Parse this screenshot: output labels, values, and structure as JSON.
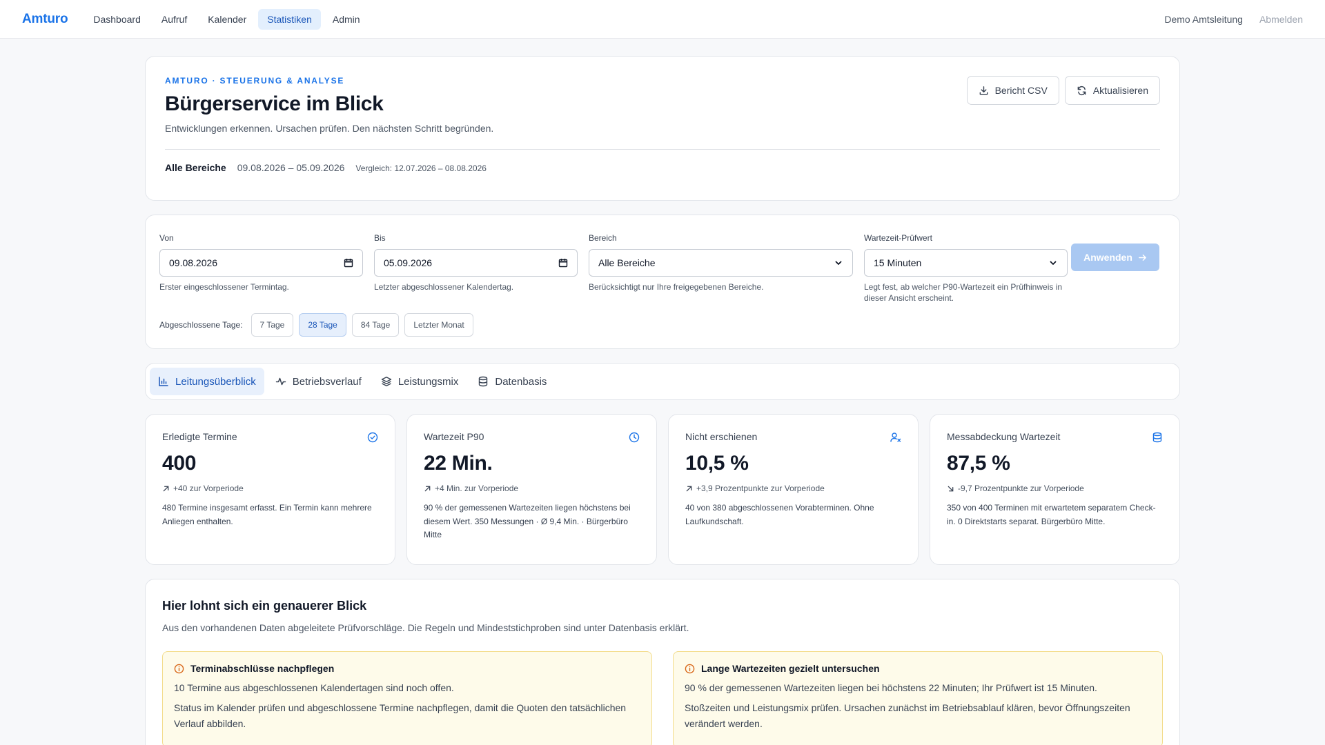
{
  "nav": {
    "brand": "Amturo",
    "links": [
      "Dashboard",
      "Aufruf",
      "Kalender",
      "Statistiken",
      "Admin"
    ],
    "active": "Statistiken",
    "user": "Demo Amtsleitung",
    "logout": "Abmelden"
  },
  "hero": {
    "eyebrow": "AMTURO · STEUERUNG & ANALYSE",
    "title": "Bürgerservice im Blick",
    "subtitle": "Entwicklungen erkennen. Ursachen prüfen. Den nächsten Schritt begründen.",
    "area": "Alle Bereiche",
    "range": "09.08.2026 – 05.09.2026",
    "compare": "Vergleich: 12.07.2026 – 08.08.2026",
    "btn_csv": "Bericht CSV",
    "btn_refresh": "Aktualisieren"
  },
  "filters": {
    "von": {
      "label": "Von",
      "value": "09.08.2026",
      "hint": "Erster eingeschlossener Termintag."
    },
    "bis": {
      "label": "Bis",
      "value": "05.09.2026",
      "hint": "Letzter abgeschlossener Kalendertag."
    },
    "bereich": {
      "label": "Bereich",
      "value": "Alle Bereiche",
      "hint": "Berücksichtigt nur Ihre freigegebenen Bereiche."
    },
    "pruefwert": {
      "label": "Wartezeit-Prüfwert",
      "value": "15 Minuten",
      "hint": "Legt fest, ab welcher P90-Wartezeit ein Prüfhinweis in dieser Ansicht erscheint."
    },
    "apply": "Anwenden",
    "quick_label": "Abgeschlossene Tage:",
    "quick": [
      "7 Tage",
      "28 Tage",
      "84 Tage",
      "Letzter Monat"
    ],
    "quick_active": "28 Tage"
  },
  "tabs": [
    "Leitungsüberblick",
    "Betriebsverlauf",
    "Leistungsmix",
    "Datenbasis"
  ],
  "kpis": [
    {
      "title": "Erledigte Termine",
      "value": "400",
      "trend": "+40 zur Vorperiode",
      "desc": "480 Termine insgesamt erfasst. Ein Termin kann mehrere Anliegen enthalten."
    },
    {
      "title": "Wartezeit P90",
      "value": "22 Min.",
      "trend": "+4 Min. zur Vorperiode",
      "desc": "90 % der gemessenen Wartezeiten liegen höchstens bei diesem Wert. 350 Messungen · Ø 9,4 Min. · Bürgerbüro Mitte"
    },
    {
      "title": "Nicht erschienen",
      "value": "10,5 %",
      "trend": "+3,9 Prozentpunkte zur Vorperiode",
      "desc": "40 von 380 abgeschlossenen Vorabterminen. Ohne Laufkundschaft."
    },
    {
      "title": "Messabdeckung Wartezeit",
      "value": "87,5 %",
      "trend": "-9,7 Prozentpunkte zur Vorperiode",
      "desc": "350 von 400 Terminen mit erwartetem separatem Check-in. 0 Direktstarts separat. Bürgerbüro Mitte."
    }
  ],
  "insights": {
    "title": "Hier lohnt sich ein genauerer Blick",
    "subtitle": "Aus den vorhandenen Daten abgeleitete Prüfvorschläge. Die Regeln und Mindeststichproben sind unter Datenbasis erklärt.",
    "cards": [
      {
        "title": "Terminabschlüsse nachpflegen",
        "text1": "10 Termine aus abgeschlossenen Kalendertagen sind noch offen.",
        "text2": "Status im Kalender prüfen und abgeschlossene Termine nachpflegen, damit die Quoten den tatsächlichen Verlauf abbilden."
      },
      {
        "title": "Lange Wartezeiten gezielt untersuchen",
        "text1": "90 % der gemessenen Wartezeiten liegen bei höchstens 22 Minuten; Ihr Prüfwert ist 15 Minuten.",
        "text2": "Stoßzeiten und Leistungsmix prüfen. Ursachen zunächst im Betriebsablauf klären, bevor Öffnungszeiten verändert werden."
      }
    ]
  },
  "colors": {
    "accent": "#1a73e8",
    "warn_bg": "#fefbea",
    "warn_border": "#f3dc8c",
    "warn_icon": "#d9681b"
  }
}
